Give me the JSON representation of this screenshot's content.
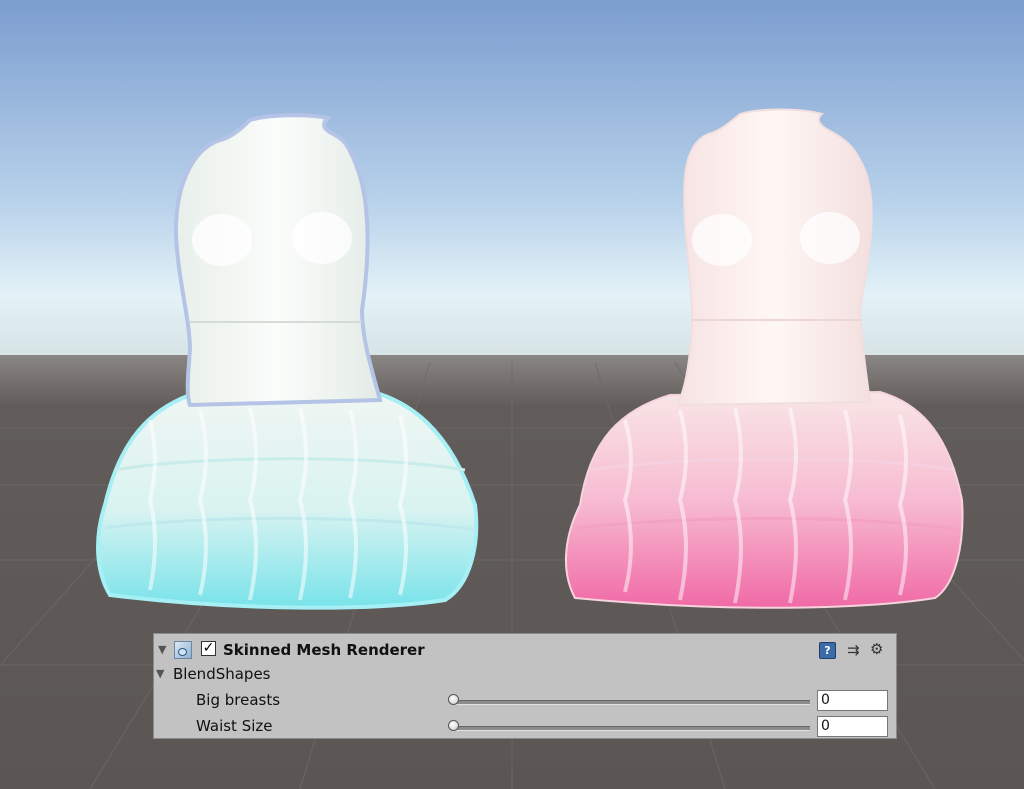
{
  "inspector": {
    "component_title": "Skinned Mesh Renderer",
    "enabled_check": "✓",
    "help_glyph": "?",
    "preset_glyph": "⇉",
    "gear_glyph": "⚙",
    "fold_glyph": "▼",
    "section_label": "BlendShapes",
    "blendshapes": [
      {
        "label": "Big breasts",
        "value": "0",
        "slider_fraction": 0
      },
      {
        "label": "Waist Size",
        "value": "0",
        "slider_fraction": 0
      }
    ]
  },
  "colors": {
    "sky_top": "#7d9fd0",
    "horizon": "#dfeef6",
    "ground": "#5e5a58",
    "dress_left_accent": "#78e3ea",
    "dress_right_accent": "#f06aa6",
    "panel_bg": "#c2c2c2"
  },
  "icons": [
    "skinned-mesh-icon",
    "help-icon",
    "preset-icon",
    "gear-icon",
    "foldout-arrow-icon",
    "checkbox-icon"
  ]
}
